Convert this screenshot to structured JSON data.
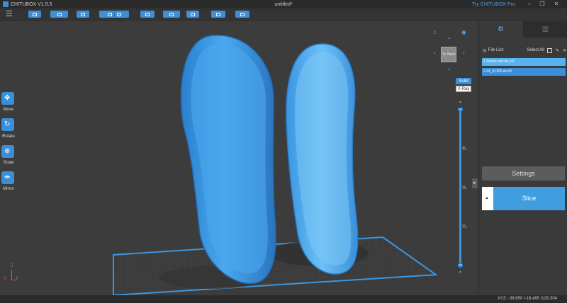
{
  "app": {
    "name": "CHITUBOX V1.9.5",
    "document_title": "untitled*",
    "promo_link": "Try CHITUBOX Pro"
  },
  "window_controls": [
    "–",
    "❐",
    "✕"
  ],
  "toolbar": {
    "menu_icon": "hamburger-icon",
    "buttons": [
      "open-file",
      "save-menu",
      "print-settings",
      "undo-redo",
      "redo",
      "copy",
      "arrange",
      "support",
      "hollow",
      "dig-hole",
      "cut"
    ]
  },
  "left_tools": [
    {
      "label": "Move",
      "icon": "move-icon"
    },
    {
      "label": "Rotate",
      "icon": "rotate-icon"
    },
    {
      "label": "Scale",
      "icon": "scale-icon"
    },
    {
      "label": "Mirror",
      "icon": "mirror-icon"
    }
  ],
  "view_cube": {
    "face_labels": [
      "Back",
      "To"
    ]
  },
  "view_modes": [
    "Solid",
    "X-Ray"
  ],
  "layer_slider": {
    "ticks": [
      "¾",
      "½",
      "¼"
    ],
    "top_value": 1,
    "bottom_value": 0
  },
  "axes": {
    "z": "Z",
    "x": "X",
    "y": "Y"
  },
  "panel": {
    "file_list_label": "File List:",
    "select_all_label": "Select All",
    "files": [
      {
        "name": "1-Shoes edit.stl.j #0"
      },
      {
        "name": "2.34_51200.stl #0"
      }
    ],
    "settings_label": "Settings",
    "slice_label": "Slice"
  },
  "status": {
    "xyz": "XYZ: -39.650 /-18.485 /128.304"
  },
  "colors": {
    "accent": "#3b8fd9",
    "model": "#3d97e2",
    "selected_file": "#56b3ef"
  }
}
